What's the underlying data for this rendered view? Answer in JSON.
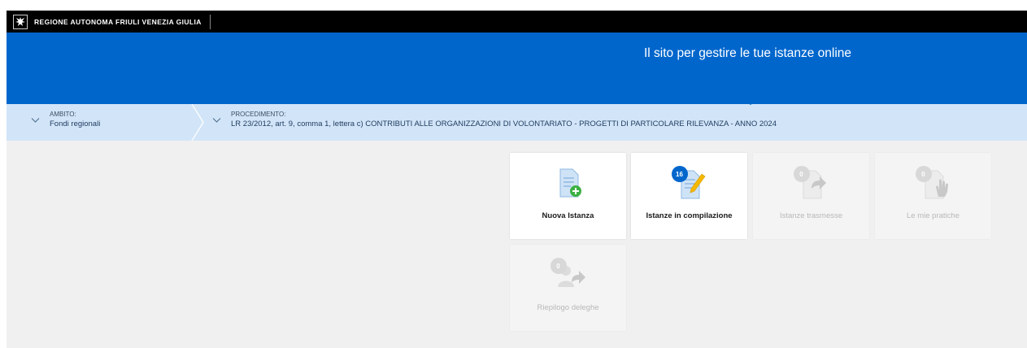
{
  "topbar": {
    "region_name": "REGIONE AUTONOMA FRIULI VENEZIA GIULIA",
    "logo_icon": "eagle-crest-icon"
  },
  "banner": {
    "tagline": "Il sito per gestire le tue istanze online",
    "color": "#0066cc"
  },
  "breadcrumb": {
    "ambito": {
      "label": "AMBITO:",
      "value": "Fondi regionali"
    },
    "procedimento": {
      "label": "PROCEDIMENTO:",
      "value": "LR 23/2012, art. 9, comma 1, lettera c) CONTRIBUTI ALLE ORGANIZZAZIONI DI VOLONTARIATO - PROGETTI DI PARTICOLARE RILEVANZA - ANNO 2024"
    }
  },
  "tiles": [
    {
      "label": "Nuova Istanza",
      "icon": "new-document-plus-icon",
      "badge": null,
      "enabled": true
    },
    {
      "label": "Istanze in compilazione",
      "icon": "document-pencil-icon",
      "badge": "16",
      "enabled": true
    },
    {
      "label": "Istanze trasmesse",
      "icon": "document-forward-icon",
      "badge": "0",
      "enabled": false
    },
    {
      "label": "Le mie pratiche",
      "icon": "document-hand-icon",
      "badge": "0",
      "enabled": false
    },
    {
      "label": "Riepilogo deleghe",
      "icon": "person-forward-icon",
      "badge": "0",
      "enabled": false
    }
  ],
  "colors": {
    "accent": "#0066cc",
    "breadcrumb_bg": "#d2e5f8",
    "content_bg": "#f0f0f0",
    "green": "#3cb043",
    "yellow": "#f5b800"
  }
}
